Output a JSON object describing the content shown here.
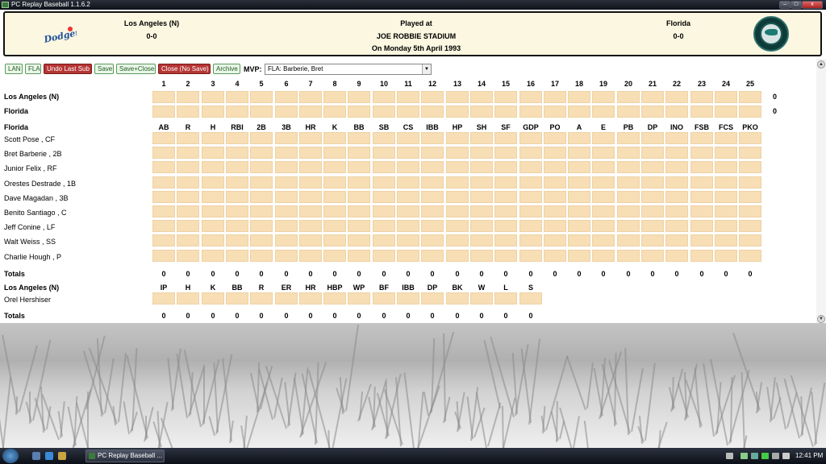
{
  "window": {
    "title": "PC Replay Baseball 1.1.6.2"
  },
  "header": {
    "home_team": "Los Angeles (N)",
    "home_score": "0-0",
    "played_at": "Played at",
    "stadium": "JOE ROBBIE STADIUM",
    "date": "On Monday 5th April 1993",
    "away_team": "Florida",
    "away_score": "0-0",
    "home_logo_text": "Dodgers"
  },
  "toolbar": {
    "buttons": [
      "LAN",
      "FLA",
      "Undo Last Sub",
      "Save",
      "Save+Close",
      "Close (No Save)",
      "Archive"
    ],
    "mvp_label": "MVP:",
    "mvp_value": "FLA: Barberie, Bret"
  },
  "linescore": {
    "innings": [
      "1",
      "2",
      "3",
      "4",
      "5",
      "6",
      "7",
      "8",
      "9",
      "10",
      "11",
      "12",
      "13",
      "14",
      "15",
      "16",
      "17",
      "18",
      "19",
      "20",
      "21",
      "22",
      "23",
      "24",
      "25"
    ],
    "rows": [
      {
        "team": "Los Angeles (N)",
        "runs": "0"
      },
      {
        "team": "Florida",
        "runs": "0"
      }
    ]
  },
  "batting": {
    "team": "Florida",
    "columns": [
      "AB",
      "R",
      "H",
      "RBI",
      "2B",
      "3B",
      "HR",
      "K",
      "BB",
      "SB",
      "CS",
      "IBB",
      "HP",
      "SH",
      "SF",
      "GDP",
      "PO",
      "A",
      "E",
      "PB",
      "DP",
      "INO",
      "FSB",
      "FCS",
      "PKO"
    ],
    "players": [
      "Scott Pose , CF",
      "Bret Barberie , 2B",
      "Junior Felix , RF",
      "Orestes Destrade , 1B",
      "Dave Magadan , 3B",
      "Benito Santiago , C",
      "Jeff Conine , LF",
      "Walt Weiss , SS",
      "Charlie Hough , P"
    ],
    "totals_label": "Totals",
    "totals": [
      "0",
      "0",
      "0",
      "0",
      "0",
      "0",
      "0",
      "0",
      "0",
      "0",
      "0",
      "0",
      "0",
      "0",
      "0",
      "0",
      "0",
      "0",
      "0",
      "0",
      "0",
      "0",
      "0",
      "0",
      "0"
    ]
  },
  "pitching": {
    "team": "Los Angeles (N)",
    "columns": [
      "IP",
      "H",
      "K",
      "BB",
      "R",
      "ER",
      "HR",
      "HBP",
      "WP",
      "BF",
      "IBB",
      "DP",
      "BK",
      "W",
      "L",
      "S"
    ],
    "players": [
      "Orel Hershiser"
    ],
    "totals_label": "Totals",
    "totals": [
      "0",
      "0",
      "0",
      "0",
      "0",
      "0",
      "0",
      "0",
      "0",
      "0",
      "0",
      "0",
      "0",
      "0",
      "0",
      "0"
    ]
  },
  "taskbar": {
    "task_label": "PC Replay Baseball ...",
    "clock": "12:41 PM"
  }
}
